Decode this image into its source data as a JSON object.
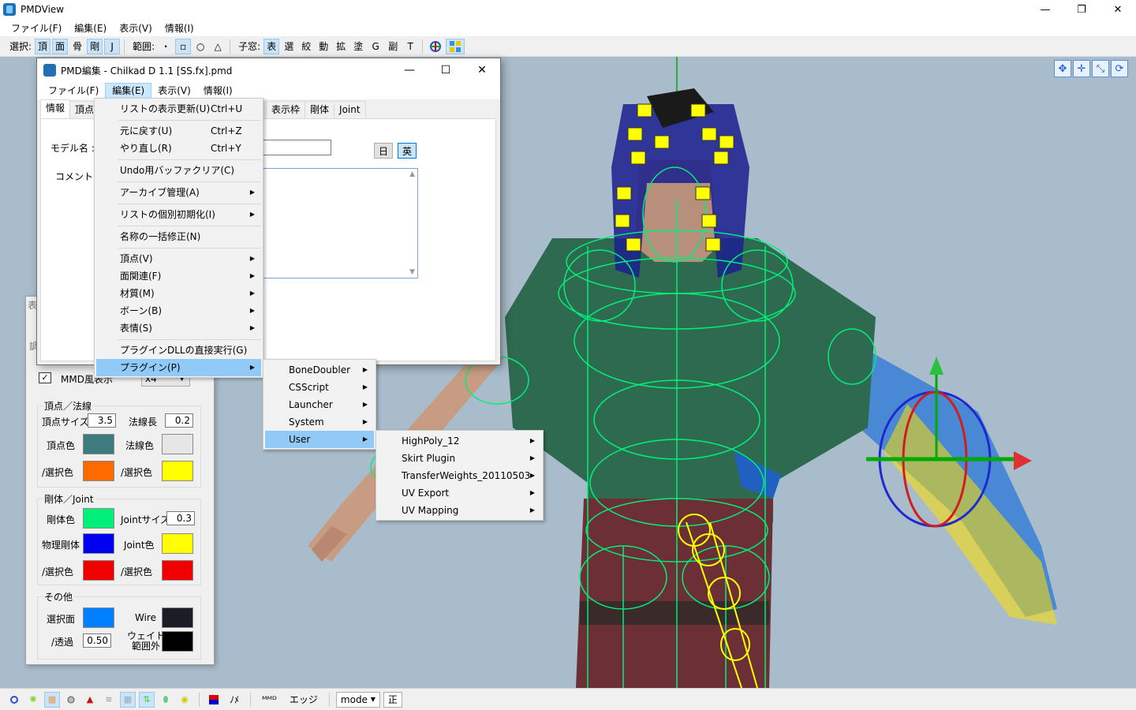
{
  "app": {
    "title": "PMDView",
    "menu": [
      "ファイル(F)",
      "編集(E)",
      "表示(V)",
      "情報(I)"
    ]
  },
  "toolbar": {
    "select_label": "選択:",
    "select_buttons": [
      "頂",
      "面",
      "骨",
      "剛",
      "J"
    ],
    "range_label": "範囲:",
    "range_buttons": [
      "・",
      "▫",
      "○",
      "△"
    ],
    "child_label": "子窓:",
    "child_buttons": [
      "表",
      "選",
      "絞",
      "動",
      "拡",
      "塗",
      "G",
      "副",
      "T"
    ]
  },
  "edit_window": {
    "title": "PMD編集 - Chilkad D 1.1 [SS.fx].pmd",
    "menu": [
      "ファイル(F)",
      "編集(E)",
      "表示(V)",
      "情報(I)"
    ],
    "tabs": [
      "情報",
      "頂点",
      "表示枠",
      "剛体",
      "Joint"
    ],
    "model_name_label": "モデル名 :",
    "comment_label": "コメント :",
    "lang_jp": "日",
    "lang_en": "英"
  },
  "edit_menu": {
    "items": [
      {
        "label": "リストの表示更新(U)",
        "shortcut": "Ctrl+U"
      },
      {
        "label": "元に戻す(U)",
        "shortcut": "Ctrl+Z"
      },
      {
        "label": "やり直し(R)",
        "shortcut": "Ctrl+Y"
      },
      {
        "label": "Undo用バッファクリア(C)"
      },
      {
        "label": "アーカイブ管理(A)"
      },
      {
        "label": "リストの個別初期化(I)"
      },
      {
        "label": "名称の一括修正(N)"
      },
      {
        "label": "頂点(V)"
      },
      {
        "label": "面関連(F)"
      },
      {
        "label": "材質(M)"
      },
      {
        "label": "ボーン(B)"
      },
      {
        "label": "表情(S)"
      },
      {
        "label": "プラグインDLLの直接実行(G)"
      },
      {
        "label": "プラグイン(P)"
      }
    ]
  },
  "plugin_menu": {
    "items": [
      "BoneDoubler",
      "CSScript",
      "Launcher",
      "System",
      "User"
    ]
  },
  "user_menu": {
    "items": [
      "HighPoly_12",
      "Skirt Plugin",
      "TransferWeights_20110503",
      "UV Export",
      "UV Mapping"
    ]
  },
  "left_panel": {
    "header": "表",
    "mmd_display_label": "MMD風表示",
    "zoom_value": "x4",
    "vertex_group": "頂点／法線",
    "vertex_size_label": "頂点サイズ",
    "vertex_size": "3.5",
    "normal_len_label": "法線長",
    "normal_len": "0.2",
    "vertex_color_label": "頂点色",
    "normal_color_label": "法線色",
    "sel_color_label": "/選択色",
    "rigid_group": "剛体／Joint",
    "rigid_color_label": "剛体色",
    "joint_size_label": "Jointサイズ",
    "joint_size": "0.3",
    "phys_rigid_label": "物理剛体",
    "joint_color_label": "Joint色",
    "other_group": "その他",
    "sel_face_label": "選択面",
    "wire_label": "Wire",
    "transparency_label": "/透過",
    "transparency": "0.50",
    "weight_out_label": "ウェイト\n範囲外",
    "colors": {
      "vertex": "#3f7a7f",
      "vertex_sel": "#ff6a00",
      "normal": "#e6e6e6",
      "normal_sel": "#ffff00",
      "rigid": "#00f07a",
      "phys_rigid": "#0000f0",
      "rigid_sel": "#f00000",
      "joint": "#ffff00",
      "joint_sel": "#f00000",
      "sel_face": "#0080ff",
      "wire": "#1c1c26",
      "weight_out": "#000000"
    }
  },
  "statusbar": {
    "label_no": "ﾉﾒ",
    "label_edge": "エッジ",
    "mode": "mode",
    "ortho": "正"
  }
}
